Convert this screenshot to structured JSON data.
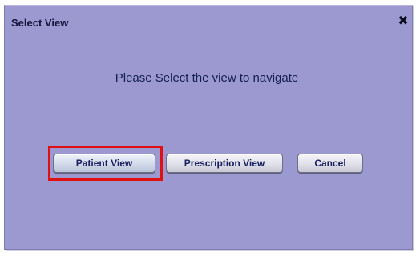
{
  "dialog": {
    "title": "Select View",
    "close_glyph": "✕",
    "message": "Please Select the view to navigate",
    "buttons": {
      "patient_view": "Patient View",
      "prescription_view": "Prescription View",
      "cancel": "Cancel"
    },
    "highlighted_button": "Patient View"
  },
  "colors": {
    "dialog_background": "#9b99cf",
    "highlight": "#e01010",
    "text": "#141e50"
  }
}
